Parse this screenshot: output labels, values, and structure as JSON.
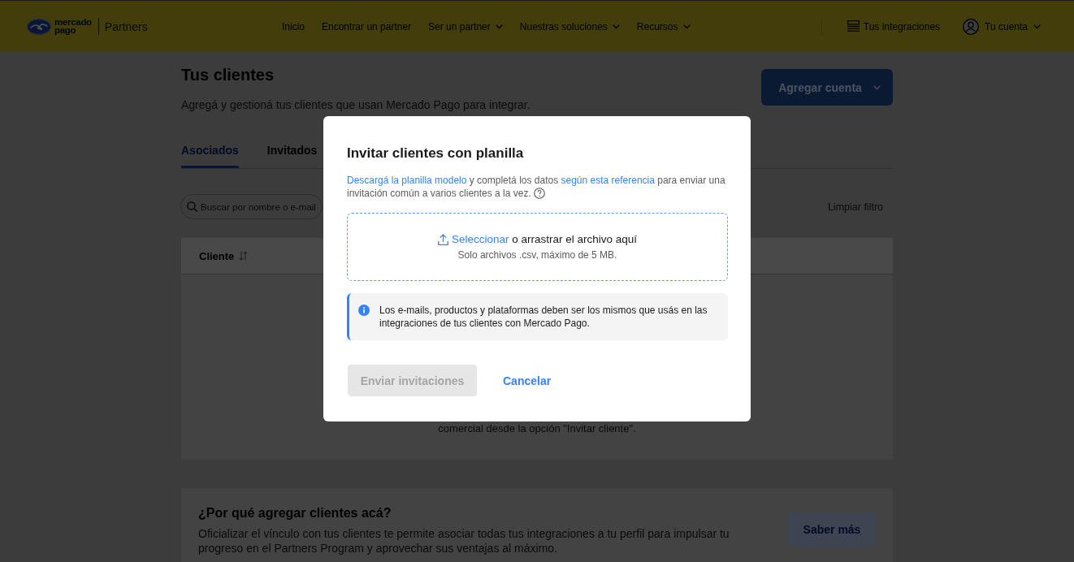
{
  "header": {
    "brand": {
      "wordmark": "mercado pago",
      "product": "Partners"
    },
    "nav": [
      {
        "label": "Inicio",
        "dropdown": false
      },
      {
        "label": "Encontrar un partner",
        "dropdown": false
      },
      {
        "label": "Ser un partner",
        "dropdown": true
      },
      {
        "label": "Nuestras soluciones",
        "dropdown": true
      },
      {
        "label": "Recursos",
        "dropdown": true
      }
    ],
    "integrations": "Tus integraciones",
    "account": {
      "label": "Tu cuenta",
      "dropdown": true
    }
  },
  "page": {
    "title": "Tus clientes",
    "subtitle": "Agregá y gestioná tus clientes que usan Mercado Pago para integrar.",
    "add_button": {
      "label": "Agregar cuenta",
      "dropdown": true
    },
    "tabs": [
      {
        "label": "Asociados",
        "selected": true
      },
      {
        "label": "Invitados",
        "selected": false
      }
    ],
    "search": {
      "placeholder": "Buscar por nombre o e-mail"
    },
    "clear_filter": "Limpiar filtro",
    "table": {
      "columns": [
        {
          "label": "Cliente",
          "sortable": true
        }
      ]
    },
    "empty_state": "comercial desde la opción \"Invitar cliente\"."
  },
  "info_card": {
    "title": "¿Por qué agregar clientes acá?",
    "text": "Oficializar el vínculo con tus clientes te permite asociar todas tus integraciones a tu perfil para impulsar tu progreso en el Partners Program y aprovechar sus ventajas al máximo.",
    "button": "Saber más"
  },
  "modal": {
    "title": "Invitar clientes con planilla",
    "description": [
      {
        "kind": "link",
        "text": "Descargá la planilla modelo"
      },
      {
        "kind": "text",
        "text": "y completá los datos"
      },
      {
        "kind": "link",
        "text": "según esta referencia"
      },
      {
        "kind": "text",
        "text": "para enviar una invitación común a varios clientes a la vez."
      }
    ],
    "dropzone": {
      "action": "Seleccionar",
      "prompt": "o arrastrar el archivo aquí",
      "hint": "Solo archivos .csv, máximo de 5 MB."
    },
    "info": "Los e-mails, productos y plataformas deben ser los mismos que usás en las integraciones de tus clientes con Mercado Pago.",
    "buttons": [
      {
        "label": "Enviar invitaciones",
        "kind": "primary",
        "disabled": true
      },
      {
        "label": "Cancelar",
        "kind": "link",
        "disabled": false
      }
    ]
  }
}
